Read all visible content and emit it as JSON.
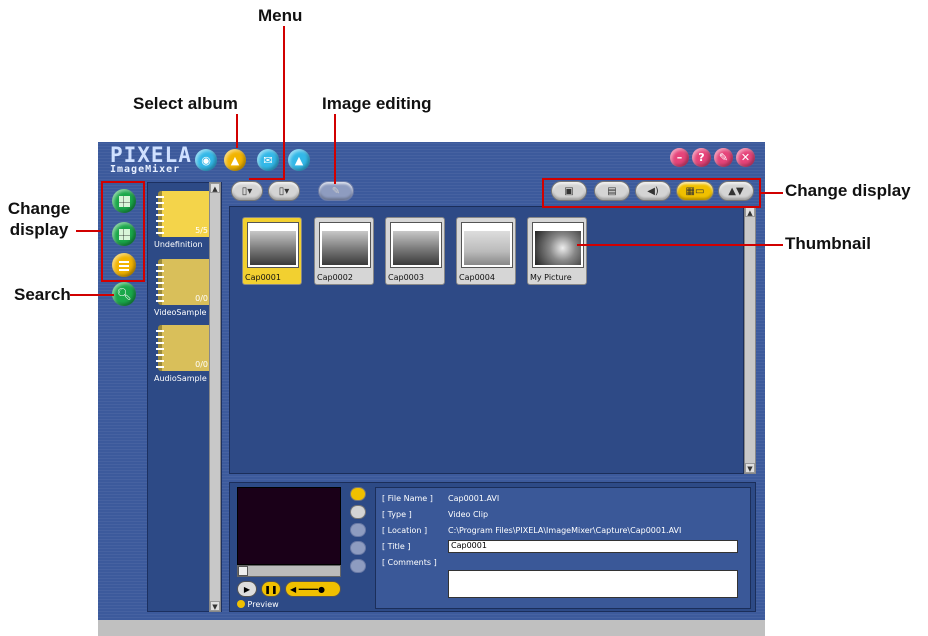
{
  "annotations": {
    "menu": "Menu",
    "select_album": "Select album",
    "image_editing": "Image editing",
    "change_display_left": "Change display",
    "change_display_right": "Change display",
    "thumbnail": "Thumbnail",
    "search": "Search"
  },
  "app": {
    "logo_line1": "PIXELA",
    "logo_line2": "ImageMixer"
  },
  "albums": [
    {
      "label": "Undefinition",
      "count": "5/5"
    },
    {
      "label": "VideoSample",
      "count": "0/0"
    },
    {
      "label": "AudioSample",
      "count": "0/0"
    }
  ],
  "thumbnails": [
    {
      "caption": "Cap0001",
      "selected": true
    },
    {
      "caption": "Cap0002",
      "selected": false
    },
    {
      "caption": "Cap0003",
      "selected": false
    },
    {
      "caption": "Cap0004",
      "selected": false
    },
    {
      "caption": "My Picture",
      "selected": false
    }
  ],
  "info": {
    "file_name_label": "[ File Name ]",
    "file_name_value": "Cap0001.AVI",
    "type_label": "[ Type ]",
    "type_value": "Video Clip",
    "location_label": "[ Location ]",
    "location_value": "C:\\Program Files\\PIXELA\\ImageMixer\\Capture\\Cap0001.AVI",
    "title_label": "[ Title ]",
    "title_value": "Cap0001",
    "comments_label": "[ Comments ]",
    "comments_value": ""
  },
  "preview_label": "Preview",
  "colors": {
    "annotation": "#d10000",
    "window": "#3c5a9c",
    "selected": "#f2d030"
  }
}
